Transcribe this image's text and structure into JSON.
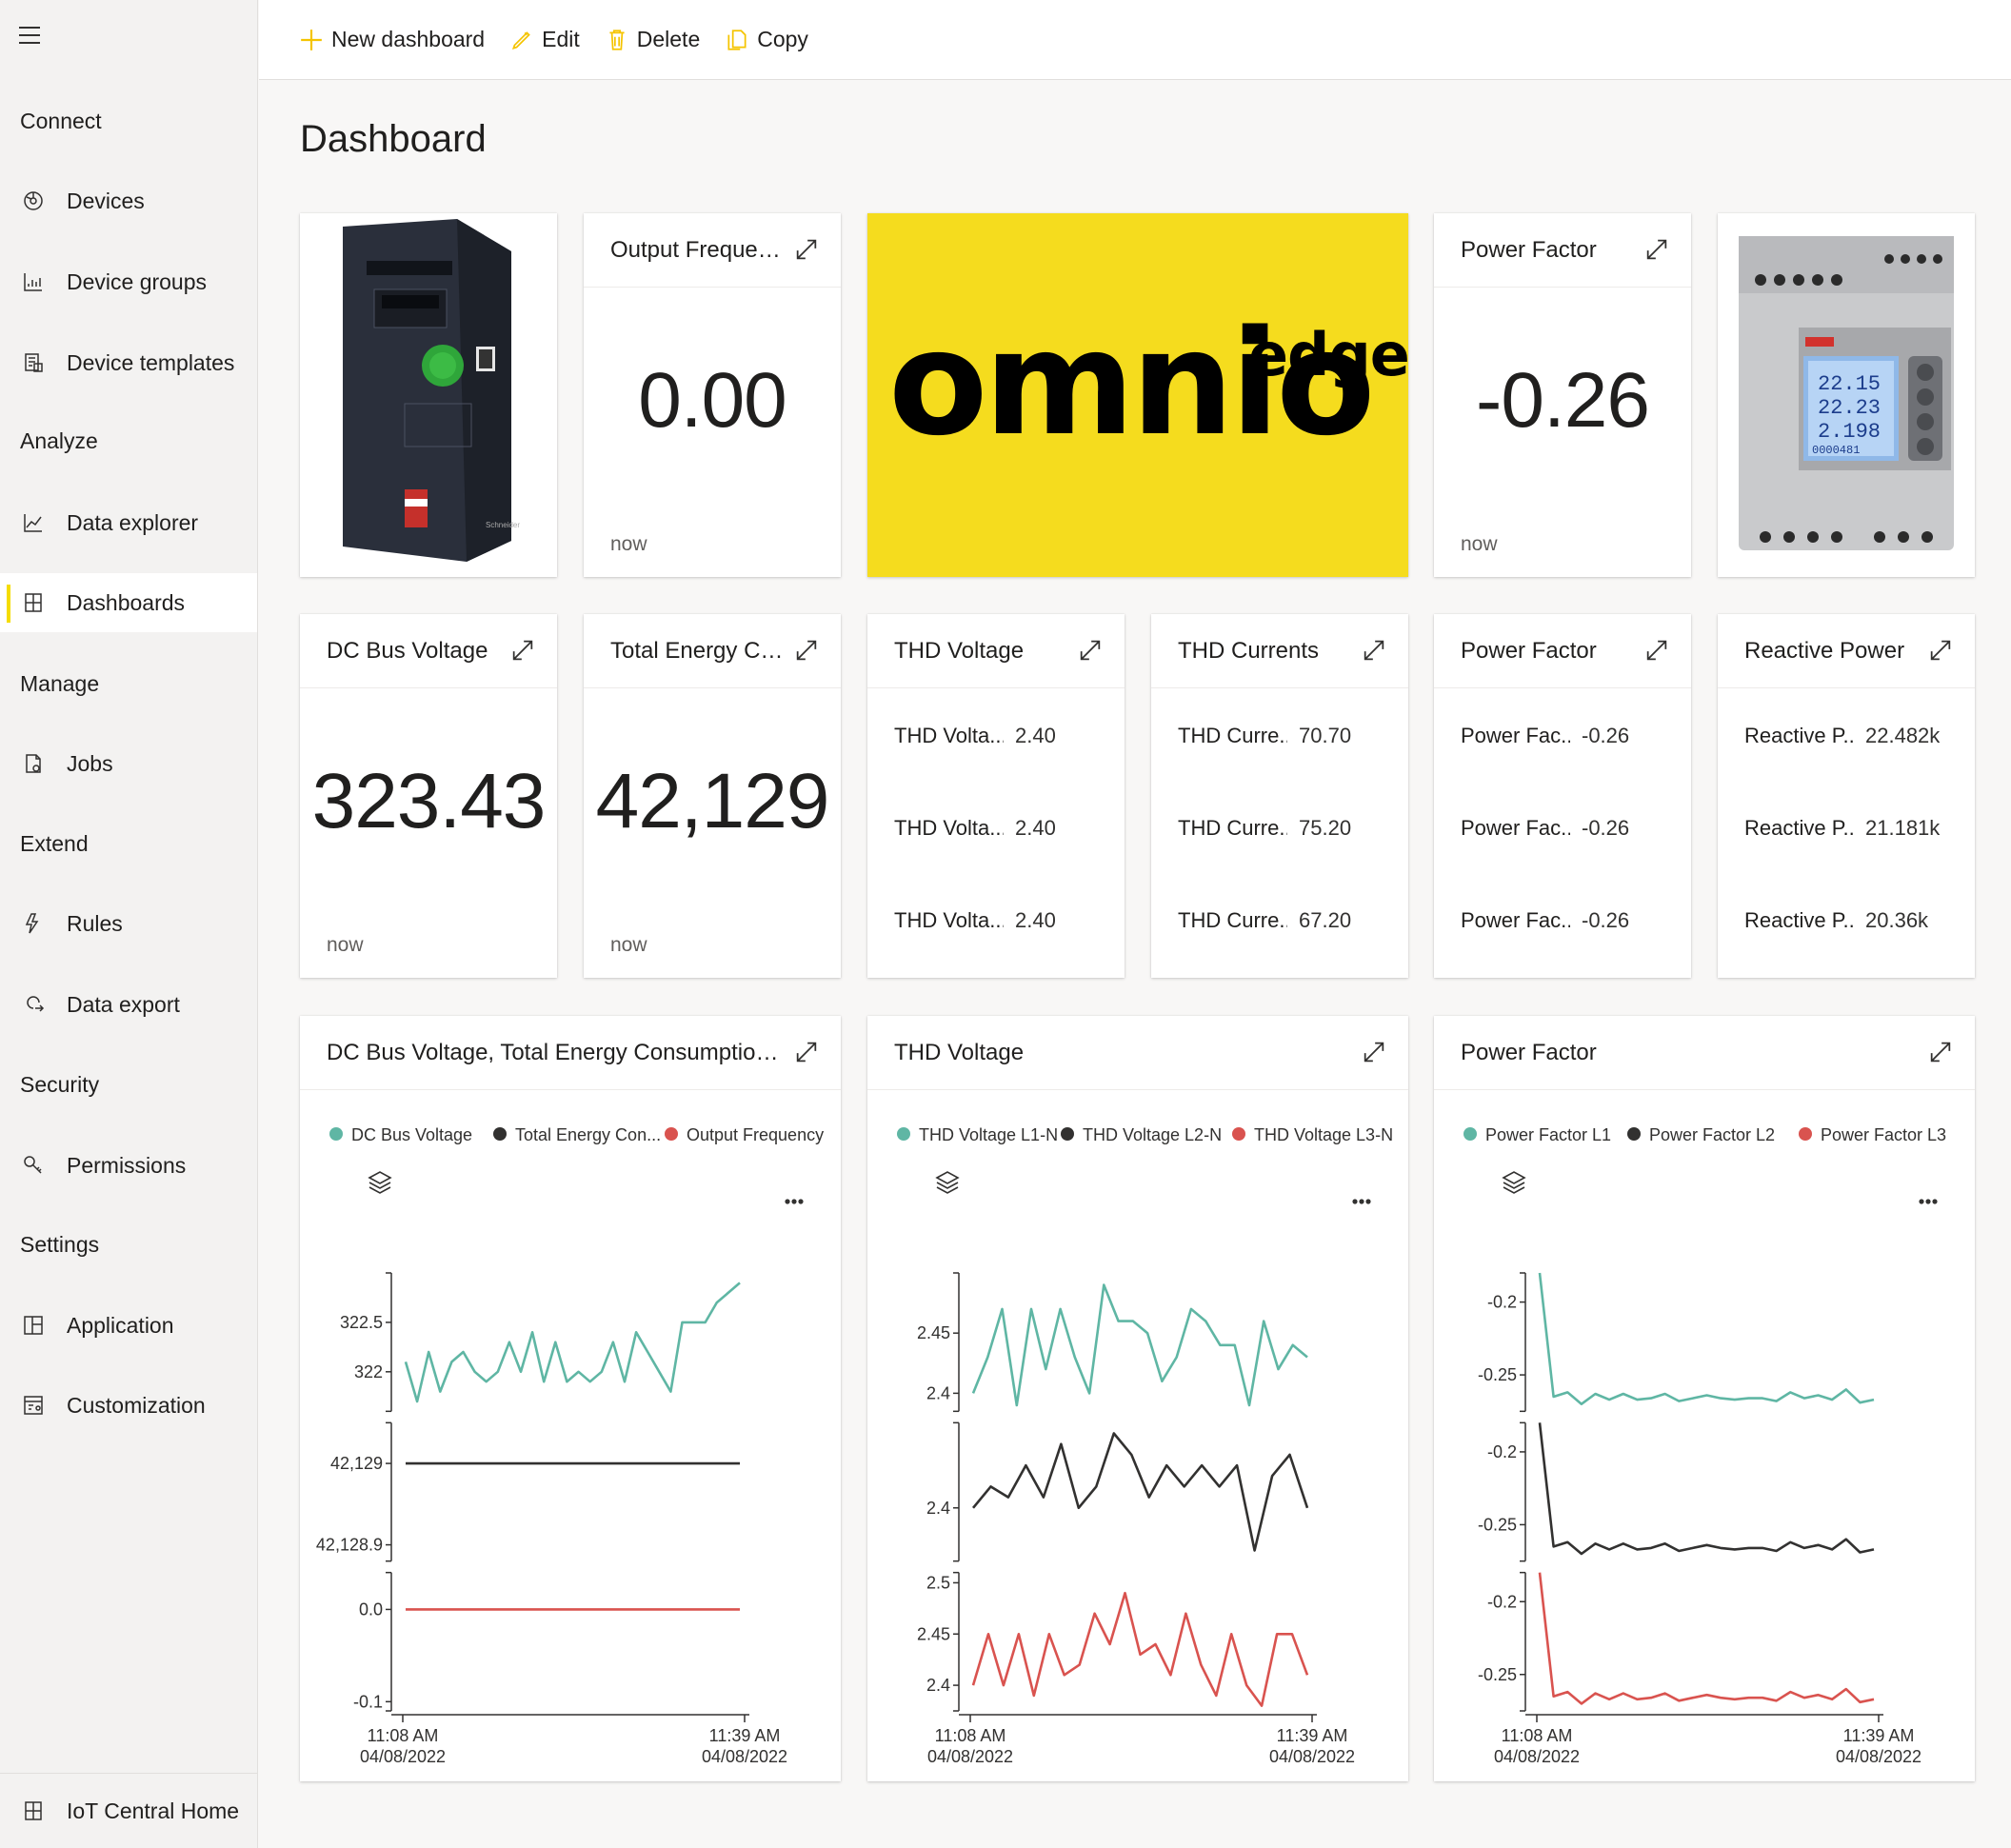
{
  "nav": {
    "sections": {
      "connect": "Connect",
      "analyze": "Analyze",
      "manage": "Manage",
      "extend": "Extend",
      "security": "Security",
      "settings": "Settings"
    },
    "items": {
      "devices": "Devices",
      "device_groups": "Device groups",
      "device_templates": "Device templates",
      "data_explorer": "Data explorer",
      "dashboards": "Dashboards",
      "jobs": "Jobs",
      "rules": "Rules",
      "data_export": "Data export",
      "permissions": "Permissions",
      "application": "Application",
      "customization": "Customization",
      "iot_home": "IoT Central Home"
    },
    "active": "Dashboards",
    "accent_color": "#f5dc00"
  },
  "toolbar": {
    "new_dashboard": "New dashboard",
    "edit": "Edit",
    "delete": "Delete",
    "copy": "Copy",
    "icon_color": "#f5c400"
  },
  "page": {
    "title": "Dashboard"
  },
  "kpi": {
    "output_frequency": {
      "title": "Output Frequency",
      "value": "0.00",
      "time": "now"
    },
    "power_factor": {
      "title": "Power Factor",
      "value": "-0.26",
      "time": "now"
    },
    "dc_bus_voltage": {
      "title": "DC Bus Voltage",
      "value": "323.43",
      "time": "now"
    },
    "total_energy": {
      "title": "Total Energy Consu...",
      "value": "42,129",
      "time": "now"
    }
  },
  "logo": {
    "word": "omnio",
    "super": "edge",
    "bg_color": "#f5dc1e"
  },
  "lists": {
    "thd_voltage": {
      "title": "THD Voltage",
      "rows": [
        {
          "k": "THD Volta...",
          "v": "2.40"
        },
        {
          "k": "THD Volta...",
          "v": "2.40"
        },
        {
          "k": "THD Volta...",
          "v": "2.40"
        }
      ]
    },
    "thd_currents": {
      "title": "THD Currents",
      "rows": [
        {
          "k": "THD Curre...",
          "v": "70.70"
        },
        {
          "k": "THD Curre...",
          "v": "75.20"
        },
        {
          "k": "THD Curre...",
          "v": "67.20"
        }
      ]
    },
    "power_factor": {
      "title": "Power Factor",
      "rows": [
        {
          "k": "Power Fac...",
          "v": "-0.26"
        },
        {
          "k": "Power Fac...",
          "v": "-0.26"
        },
        {
          "k": "Power Fac...",
          "v": "-0.26"
        }
      ]
    },
    "reactive_power": {
      "title": "Reactive Power",
      "rows": [
        {
          "k": "Reactive P...",
          "v": "22.482k"
        },
        {
          "k": "Reactive P...",
          "v": "21.181k"
        },
        {
          "k": "Reactive P...",
          "v": "20.36k"
        }
      ]
    }
  },
  "chart_data": [
    {
      "type": "line",
      "title": "DC Bus Voltage, Total Energy Consumption, Output Freq...",
      "x_start": "11:08 AM 04/08/2022",
      "x_end": "11:39 AM 04/08/2022",
      "series": [
        {
          "name": "DC Bus Voltage",
          "color": "#5fb6a4",
          "ticks": [
            "322.5",
            "322"
          ],
          "ylim": [
            321.6,
            323.0
          ],
          "values": [
            322.1,
            321.7,
            322.2,
            321.8,
            322.1,
            322.2,
            322.0,
            321.9,
            322.0,
            322.3,
            322.0,
            322.4,
            321.9,
            322.3,
            321.9,
            322.0,
            321.9,
            322.0,
            322.3,
            321.9,
            322.4,
            322.2,
            322.0,
            321.8,
            322.5,
            322.5,
            322.5,
            322.7,
            322.8,
            322.9
          ]
        },
        {
          "name": "Total Energy Con...",
          "color": "#323130",
          "ticks": [
            "42,129",
            "42,128.9"
          ],
          "ylim": [
            42128.88,
            42129.05
          ],
          "values": [
            42129,
            42129,
            42129,
            42129,
            42129,
            42129,
            42129,
            42129,
            42129,
            42129
          ]
        },
        {
          "name": "Output Frequency",
          "color": "#d9534f",
          "ticks": [
            "0.0",
            "-0.1"
          ],
          "ylim": [
            -0.11,
            0.04
          ],
          "values": [
            0,
            0,
            0,
            0,
            0,
            0,
            0,
            0,
            0,
            0
          ]
        }
      ]
    },
    {
      "type": "line",
      "title": "THD Voltage",
      "x_start": "11:08 AM 04/08/2022",
      "x_end": "11:39 AM 04/08/2022",
      "series": [
        {
          "name": "THD Voltage L1-N",
          "color": "#5fb6a4",
          "ticks": [
            "2.45",
            "2.4"
          ],
          "ylim": [
            2.385,
            2.5
          ],
          "values": [
            2.4,
            2.43,
            2.47,
            2.39,
            2.47,
            2.42,
            2.47,
            2.43,
            2.4,
            2.49,
            2.46,
            2.46,
            2.45,
            2.41,
            2.43,
            2.47,
            2.46,
            2.44,
            2.44,
            2.39,
            2.46,
            2.42,
            2.44,
            2.43
          ]
        },
        {
          "name": "THD Voltage L2-N",
          "color": "#323130",
          "ticks": [
            "2.4"
          ],
          "ylim": [
            2.35,
            2.48
          ],
          "values": [
            2.4,
            2.42,
            2.41,
            2.44,
            2.41,
            2.46,
            2.4,
            2.42,
            2.47,
            2.45,
            2.41,
            2.44,
            2.42,
            2.44,
            2.42,
            2.44,
            2.36,
            2.43,
            2.45,
            2.4
          ]
        },
        {
          "name": "THD Voltage L3-N",
          "color": "#d9534f",
          "ticks": [
            "2.5",
            "2.45",
            "2.4"
          ],
          "ylim": [
            2.375,
            2.51
          ],
          "values": [
            2.4,
            2.45,
            2.4,
            2.45,
            2.39,
            2.45,
            2.41,
            2.42,
            2.47,
            2.44,
            2.49,
            2.43,
            2.44,
            2.41,
            2.47,
            2.42,
            2.39,
            2.45,
            2.4,
            2.38,
            2.45,
            2.45,
            2.41
          ]
        }
      ]
    },
    {
      "type": "line",
      "title": "Power Factor",
      "x_start": "11:08 AM 04/08/2022",
      "x_end": "11:39 AM 04/08/2022",
      "series": [
        {
          "name": "Power Factor L1",
          "color": "#5fb6a4",
          "ticks": [
            "-0.2",
            "-0.25"
          ],
          "ylim": [
            -0.275,
            -0.18
          ],
          "values": [
            -0.18,
            -0.265,
            -0.262,
            -0.27,
            -0.263,
            -0.267,
            -0.263,
            -0.267,
            -0.266,
            -0.263,
            -0.268,
            -0.266,
            -0.264,
            -0.266,
            -0.267,
            -0.266,
            -0.266,
            -0.268,
            -0.262,
            -0.266,
            -0.264,
            -0.267,
            -0.26,
            -0.269,
            -0.267
          ]
        },
        {
          "name": "Power Factor L2",
          "color": "#323130",
          "ticks": [
            "-0.2",
            "-0.25"
          ],
          "ylim": [
            -0.275,
            -0.18
          ],
          "values": [
            -0.18,
            -0.265,
            -0.262,
            -0.27,
            -0.263,
            -0.267,
            -0.263,
            -0.267,
            -0.266,
            -0.263,
            -0.268,
            -0.266,
            -0.264,
            -0.266,
            -0.267,
            -0.266,
            -0.266,
            -0.268,
            -0.262,
            -0.266,
            -0.264,
            -0.267,
            -0.26,
            -0.269,
            -0.267
          ]
        },
        {
          "name": "Power Factor L3",
          "color": "#d9534f",
          "ticks": [
            "-0.2",
            "-0.25"
          ],
          "ylim": [
            -0.275,
            -0.18
          ],
          "values": [
            -0.18,
            -0.265,
            -0.262,
            -0.27,
            -0.263,
            -0.267,
            -0.263,
            -0.267,
            -0.266,
            -0.263,
            -0.268,
            -0.266,
            -0.264,
            -0.266,
            -0.267,
            -0.266,
            -0.266,
            -0.268,
            -0.262,
            -0.266,
            -0.264,
            -0.267,
            -0.26,
            -0.269,
            -0.267
          ]
        }
      ]
    }
  ]
}
